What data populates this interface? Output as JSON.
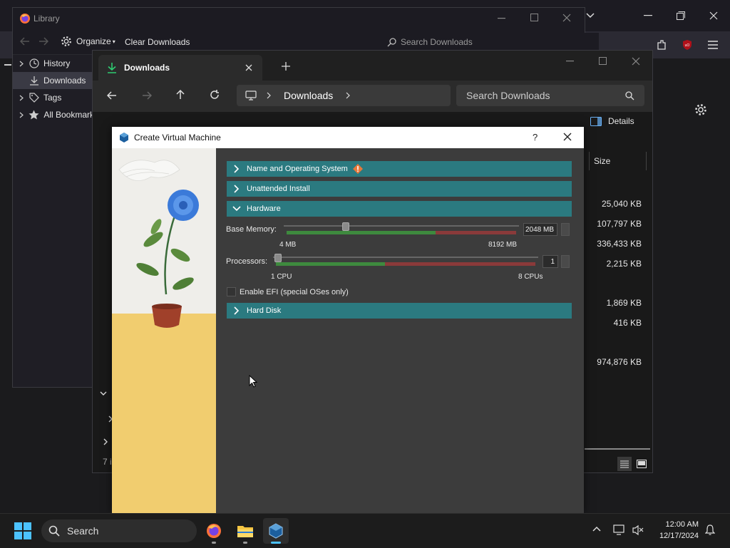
{
  "library": {
    "title": "Library",
    "toolbar": {
      "organize_label": "Organize",
      "clear_downloads_label": "Clear Downloads",
      "search_placeholder": "Search Downloads"
    },
    "sidebar": [
      {
        "label": "History",
        "icon": "clock-icon"
      },
      {
        "label": "Downloads",
        "icon": "download-icon"
      },
      {
        "label": "Tags",
        "icon": "tag-icon"
      },
      {
        "label": "All Bookmarks",
        "icon": "star-icon"
      }
    ]
  },
  "explorer": {
    "tab_title": "Downloads",
    "address": {
      "location": "Downloads"
    },
    "search_placeholder": "Search Downloads",
    "details_label": "Details",
    "column_size": "Size",
    "sizes": [
      "25,040 KB",
      "107,797 KB",
      "336,433 KB",
      "2,215 KB",
      "1,869 KB",
      "416 KB",
      "974,876 KB"
    ],
    "status_text": "7 i"
  },
  "vbox": {
    "title": "Create Virtual Machine",
    "help_label": "?",
    "sections": {
      "name_os": "Name and Operating System",
      "unattended": "Unattended Install",
      "hardware": "Hardware",
      "hard_disk": "Hard Disk"
    },
    "memory": {
      "label": "Base Memory:",
      "value": "2048 MB",
      "min_label": "4 MB",
      "max_label": "8192 MB",
      "fraction": 0.25
    },
    "processors": {
      "label": "Processors:",
      "value": "1",
      "min_label": "1 CPU",
      "max_label": "8 CPUs",
      "fraction": 0.0
    },
    "efi_label": "Enable EFI (special OSes only)",
    "colors": {
      "section_bg": "#2b7a80",
      "slider_green": "#3e8a3e",
      "slider_red": "#8a3a3a",
      "warning": "#e8783a"
    }
  },
  "taskbar": {
    "search_placeholder": "Search",
    "time": "12:00 AM",
    "date": "12/17/2024"
  }
}
